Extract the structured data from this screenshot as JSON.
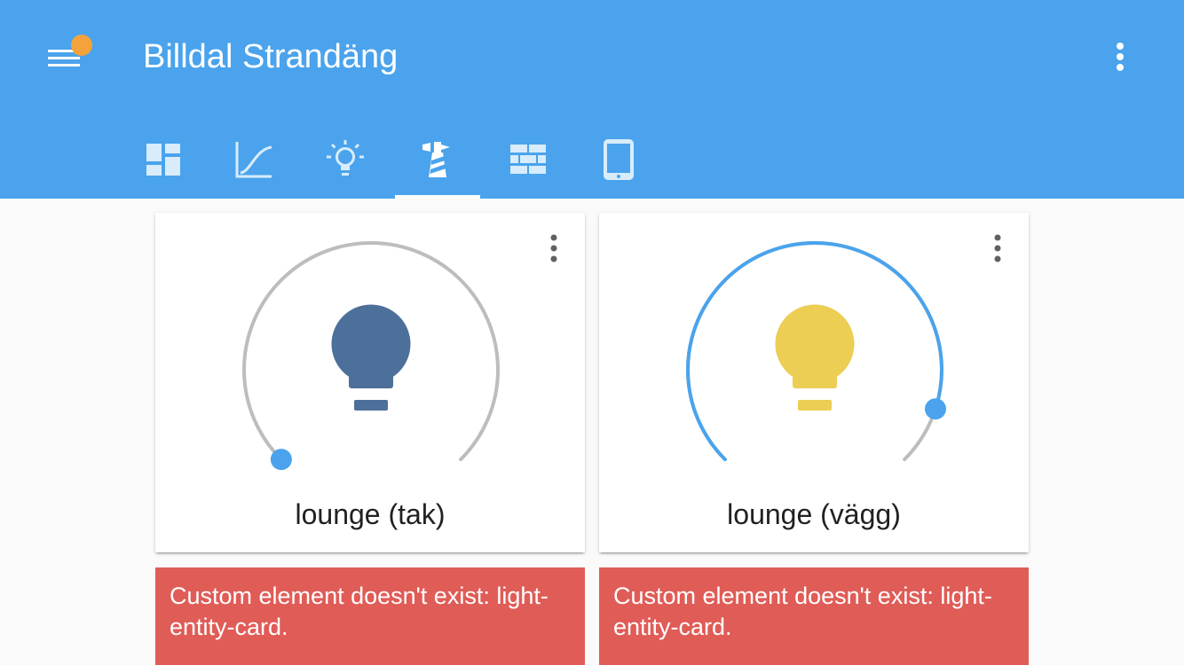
{
  "app": {
    "title": "Billdal Strandäng"
  },
  "tabs": [
    {
      "icon": "view-dashboard-icon",
      "selected": false
    },
    {
      "icon": "chart-line-icon",
      "selected": false
    },
    {
      "icon": "lightbulb-outline-icon",
      "selected": false
    },
    {
      "icon": "lighthouse-icon",
      "selected": true
    },
    {
      "icon": "wall-icon",
      "selected": false
    },
    {
      "icon": "tablet-icon",
      "selected": false
    }
  ],
  "cards": [
    {
      "name": "lounge (tak)",
      "state": "off",
      "brightness_fraction": 0.0,
      "bulb_color": "#4c7099"
    },
    {
      "name": "lounge (vägg)",
      "state": "on",
      "brightness_fraction": 0.9,
      "bulb_color": "#ebce53"
    }
  ],
  "errors": [
    {
      "message": "Custom element doesn't exist: light-entity-card."
    },
    {
      "message": "Custom element doesn't exist: light-entity-card."
    }
  ],
  "colors": {
    "header": "#4aa3ec",
    "badge": "#f3a23c",
    "accent": "#4aa3ec",
    "track": "#bdbdbd",
    "error": "#e05c57"
  }
}
